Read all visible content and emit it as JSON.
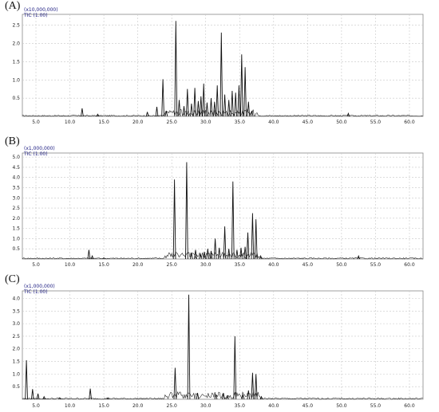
{
  "chart_data": [
    {
      "type": "line",
      "panel_label": "(A)",
      "scale_label": "(x10,000,000)",
      "series_label": "TIC (1.00)",
      "xlim": [
        3.0,
        62.0
      ],
      "x_ticks": [
        "5.0",
        "10.0",
        "15.0",
        "20.0",
        "25.0",
        "30.0",
        "35.0",
        "40.0",
        "45.0",
        "50.0",
        "55.0",
        "60.0"
      ],
      "ylim": [
        0,
        2.8
      ],
      "y_ticks": [
        "0.5",
        "1.0",
        "1.5",
        "2.0",
        "2.5"
      ],
      "peaks": [
        {
          "x": 11.8,
          "y": 0.22
        },
        {
          "x": 14.1,
          "y": 0.06
        },
        {
          "x": 21.4,
          "y": 0.12
        },
        {
          "x": 22.8,
          "y": 0.26
        },
        {
          "x": 24.2,
          "y": 0.15
        },
        {
          "x": 23.7,
          "y": 1.02
        },
        {
          "x": 25.6,
          "y": 2.62
        },
        {
          "x": 26.1,
          "y": 0.45
        },
        {
          "x": 26.8,
          "y": 0.28
        },
        {
          "x": 27.3,
          "y": 0.75
        },
        {
          "x": 27.9,
          "y": 0.35
        },
        {
          "x": 28.4,
          "y": 0.78
        },
        {
          "x": 28.9,
          "y": 0.42
        },
        {
          "x": 29.3,
          "y": 0.55
        },
        {
          "x": 29.7,
          "y": 0.9
        },
        {
          "x": 30.2,
          "y": 0.38
        },
        {
          "x": 30.8,
          "y": 0.5
        },
        {
          "x": 31.3,
          "y": 0.4
        },
        {
          "x": 31.7,
          "y": 0.85
        },
        {
          "x": 32.3,
          "y": 2.3
        },
        {
          "x": 32.8,
          "y": 0.6
        },
        {
          "x": 33.4,
          "y": 0.45
        },
        {
          "x": 33.9,
          "y": 0.7
        },
        {
          "x": 34.4,
          "y": 0.65
        },
        {
          "x": 34.9,
          "y": 0.85
        },
        {
          "x": 35.3,
          "y": 1.7
        },
        {
          "x": 35.8,
          "y": 1.35
        },
        {
          "x": 36.3,
          "y": 0.4
        },
        {
          "x": 36.8,
          "y": 0.15
        },
        {
          "x": 51.0,
          "y": 0.08
        }
      ]
    },
    {
      "type": "line",
      "panel_label": "(B)",
      "scale_label": "(x1,000,000)",
      "series_label": "TIC (1.00)",
      "xlim": [
        3.0,
        62.0
      ],
      "x_ticks": [
        "5.0",
        "10.0",
        "15.0",
        "20.0",
        "25.0",
        "30.0",
        "35.0",
        "40.0",
        "45.0",
        "50.0",
        "55.0",
        "60.0"
      ],
      "ylim": [
        0,
        5.2
      ],
      "y_ticks": [
        "0.5",
        "1.0",
        "1.5",
        "2.0",
        "2.5",
        "3.0",
        "3.5",
        "4.0",
        "4.5",
        "5.0"
      ],
      "peaks": [
        {
          "x": 12.8,
          "y": 0.45
        },
        {
          "x": 13.3,
          "y": 0.15
        },
        {
          "x": 15.0,
          "y": 0.06
        },
        {
          "x": 25.4,
          "y": 3.9
        },
        {
          "x": 27.2,
          "y": 4.75
        },
        {
          "x": 27.9,
          "y": 0.3
        },
        {
          "x": 28.5,
          "y": 0.45
        },
        {
          "x": 29.2,
          "y": 0.25
        },
        {
          "x": 29.8,
          "y": 0.35
        },
        {
          "x": 30.3,
          "y": 0.5
        },
        {
          "x": 30.8,
          "y": 0.4
        },
        {
          "x": 31.4,
          "y": 1.0
        },
        {
          "x": 32.0,
          "y": 0.55
        },
        {
          "x": 32.8,
          "y": 1.6
        },
        {
          "x": 33.4,
          "y": 0.5
        },
        {
          "x": 34.0,
          "y": 3.8
        },
        {
          "x": 34.6,
          "y": 0.45
        },
        {
          "x": 35.2,
          "y": 0.55
        },
        {
          "x": 35.8,
          "y": 0.6
        },
        {
          "x": 36.2,
          "y": 1.3
        },
        {
          "x": 36.9,
          "y": 2.25
        },
        {
          "x": 37.4,
          "y": 1.95
        },
        {
          "x": 38.1,
          "y": 0.15
        },
        {
          "x": 52.5,
          "y": 0.15
        }
      ]
    },
    {
      "type": "line",
      "panel_label": "(C)",
      "scale_label": "(x1,000,000)",
      "series_label": "TIC (1.00)",
      "xlim": [
        3.0,
        62.0
      ],
      "x_ticks": [
        "5.0",
        "10.0",
        "15.0",
        "20.0",
        "25.0",
        "30.0",
        "35.0",
        "40.0",
        "45.0",
        "50.0",
        "55.0",
        "60.0"
      ],
      "ylim": [
        0,
        4.3
      ],
      "y_ticks": [
        "0.5",
        "1.0",
        "1.5",
        "2.0",
        "2.5",
        "3.0",
        "3.5",
        "4.0"
      ],
      "peaks": [
        {
          "x": 3.6,
          "y": 1.55
        },
        {
          "x": 4.5,
          "y": 0.4
        },
        {
          "x": 5.3,
          "y": 0.22
        },
        {
          "x": 6.2,
          "y": 0.1
        },
        {
          "x": 8.5,
          "y": 0.06
        },
        {
          "x": 13.0,
          "y": 0.42
        },
        {
          "x": 15.6,
          "y": 0.06
        },
        {
          "x": 25.5,
          "y": 1.25
        },
        {
          "x": 27.5,
          "y": 4.15
        },
        {
          "x": 28.8,
          "y": 0.25
        },
        {
          "x": 31.5,
          "y": 0.2
        },
        {
          "x": 32.6,
          "y": 0.25
        },
        {
          "x": 33.2,
          "y": 0.12
        },
        {
          "x": 34.3,
          "y": 2.5
        },
        {
          "x": 35.5,
          "y": 0.18
        },
        {
          "x": 36.3,
          "y": 0.35
        },
        {
          "x": 36.9,
          "y": 1.05
        },
        {
          "x": 37.4,
          "y": 1.0
        },
        {
          "x": 38.2,
          "y": 0.1
        }
      ]
    }
  ]
}
